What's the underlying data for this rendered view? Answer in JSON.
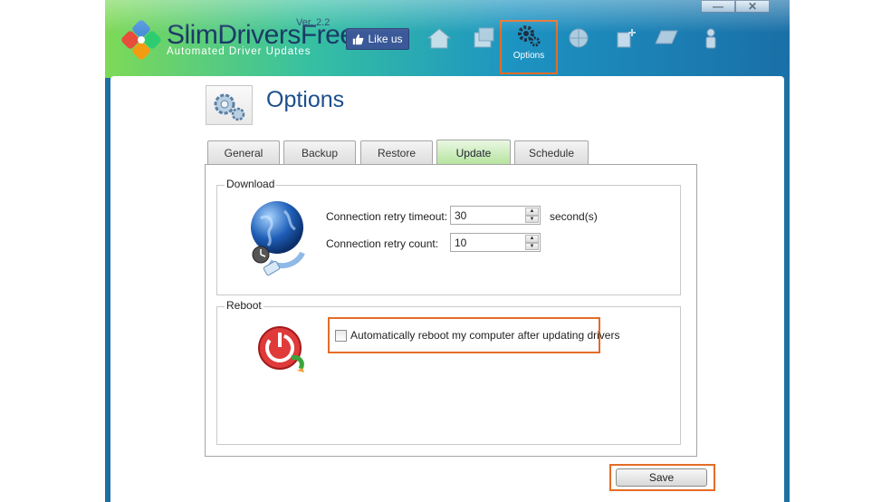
{
  "app": {
    "brand_slim": "SlimDrivers",
    "brand_free": "Free",
    "version": "Ver. 2.2",
    "tagline": "Automated Driver Updates",
    "like_label": "Like us",
    "colors": {
      "accent_orange": "#e46c27",
      "title_blue": "#1c4f8c",
      "facebook_blue": "#3b5998"
    }
  },
  "nav": {
    "items": [
      {
        "name": "home-icon"
      },
      {
        "name": "drivers-icon"
      },
      {
        "name": "options-icon",
        "label": "Options",
        "active": true
      },
      {
        "name": "network-icon"
      },
      {
        "name": "plugin-icon"
      },
      {
        "name": "monitor-icon"
      },
      {
        "name": "user-icon"
      }
    ]
  },
  "window_buttons": {
    "minimize": "—",
    "close": "✕"
  },
  "page": {
    "title": "Options",
    "icon": "options-gear-icon"
  },
  "tabs": [
    {
      "label": "General"
    },
    {
      "label": "Backup"
    },
    {
      "label": "Restore"
    },
    {
      "label": "Update",
      "active": true
    },
    {
      "label": "Schedule"
    }
  ],
  "download": {
    "title": "Download",
    "retry_timeout_label": "Connection retry timeout:",
    "retry_timeout_value": "30",
    "retry_timeout_unit": "second(s)",
    "retry_count_label": "Connection retry count:",
    "retry_count_value": "10"
  },
  "reboot": {
    "title": "Reboot",
    "auto_reboot_label": "Automatically reboot my computer after updating drivers",
    "auto_reboot_checked": false
  },
  "save_label": "Save"
}
